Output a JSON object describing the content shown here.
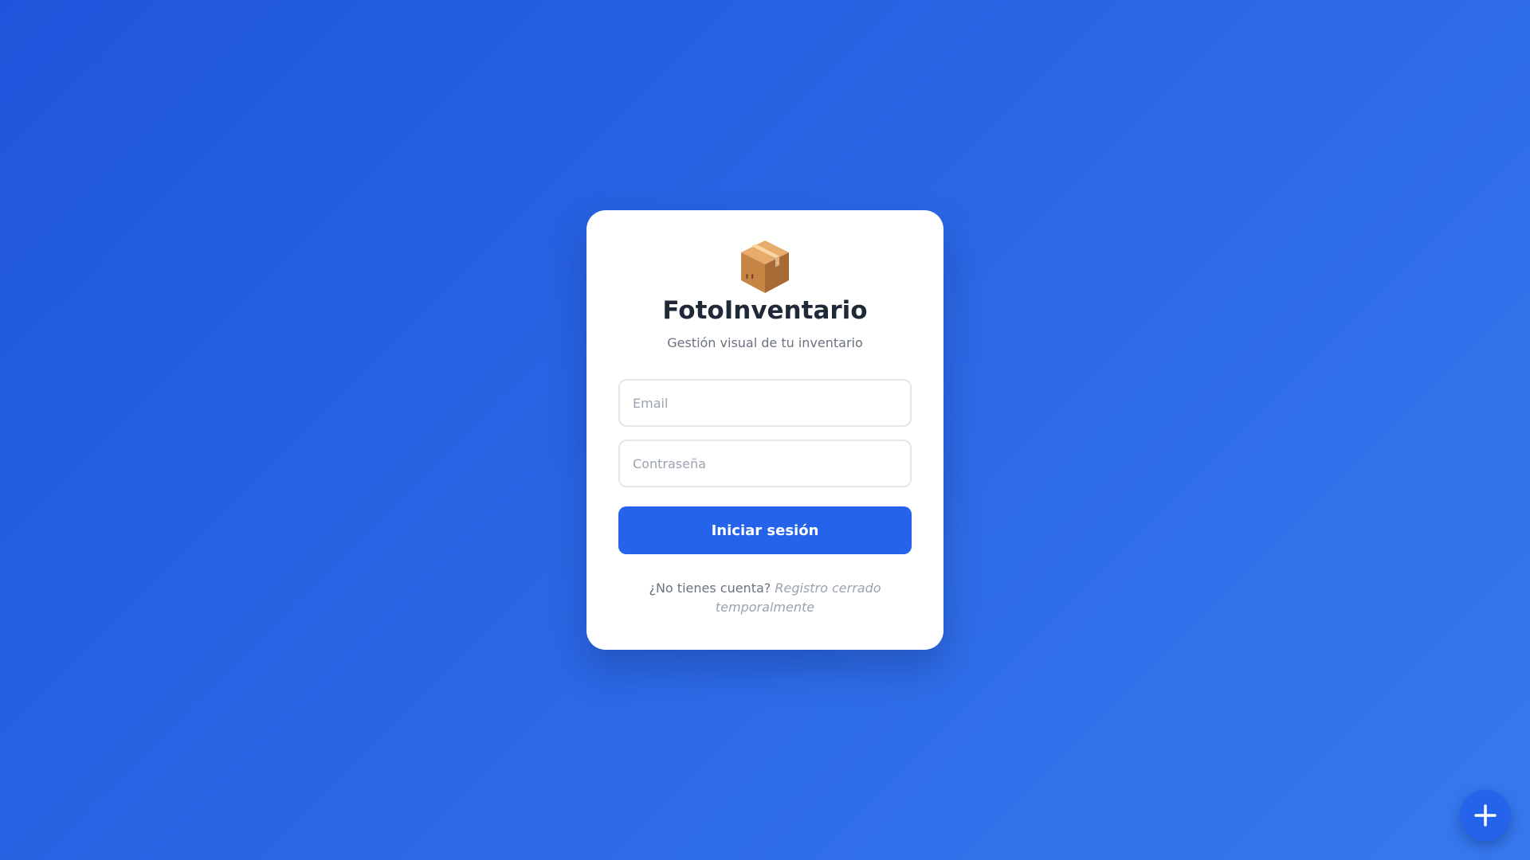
{
  "app": {
    "title": "FotoInventario",
    "subtitle": "Gestión visual de tu inventario",
    "logo_icon": "package-box-icon"
  },
  "form": {
    "email_placeholder": "Email",
    "email_value": "",
    "password_placeholder": "Contraseña",
    "password_value": "",
    "submit_label": "Iniciar sesión"
  },
  "footer": {
    "question": "¿No tienes cuenta?",
    "registration_status": "Registro cerrado temporalmente"
  },
  "fab": {
    "icon": "plus-icon"
  },
  "colors": {
    "background_start": "#1f55dc",
    "background_end": "#3679ef",
    "accent": "#2563eb",
    "title_text": "#1f2937",
    "muted_text": "#6b7280"
  }
}
